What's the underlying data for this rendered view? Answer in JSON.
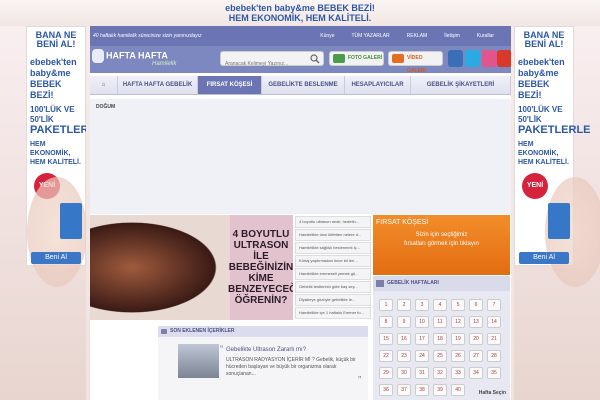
{
  "banner": {
    "line1": "ebebek'ten baby&me BEBEK BEZİ!",
    "line2": "HEM EKONOMİK, HEM KALİTELİ."
  },
  "ad": {
    "bana": "BANA NE",
    "beni": "BENİ AL!",
    "brand_lines": [
      "ebebek'ten",
      "baby&me",
      "BEBEK BEZİ!"
    ],
    "pack_prefix": "100'LÜK VE 50'LİK",
    "pack": "PAKETLERLE",
    "eco_lines": [
      "HEM EKONOMİK,",
      "HEM KALİTELİ."
    ],
    "yeni": "YENİ",
    "button": "Beni Al"
  },
  "topbar": {
    "tagline": "40 haftalık hamilelik sürecinize sizin yanınızdayız",
    "links": [
      "Künye",
      "TÜM YAZARLAR",
      "REKLAM",
      "İletişim",
      "Kurallar"
    ]
  },
  "header": {
    "logo": "HAFTA HAFTA",
    "logo_sub": "Hamilelik",
    "search_placeholder": "Aranacak Kelimeyi Yazınız...",
    "foto": "FOTO GALERİ",
    "video": "VİDEO GALERİ"
  },
  "nav": {
    "items": [
      "HAFTA HAFTA GEBELİK",
      "FIRSAT KÖŞESİ",
      "GEBELİKTE BESLENME",
      "HESAPLAYICILAR",
      "GEBELİK ŞİKAYETLERİ"
    ]
  },
  "dogum": "DOĞUM",
  "slide": {
    "text_lines": [
      "4 BOYUTLU",
      "ULTRASON İLE",
      "BEBEĞİNİZİN",
      "KİME",
      "BENZEYECEĞİNİ",
      "ÖĞRENİN?"
    ],
    "list": [
      "4 boyutlu ultrason nedir, hedefin...",
      "Hamilelikte ünsi lütfetten nelere d...",
      "Hamilelikte sağlıklı beslenmek iç...",
      "Kürtaj yaptırmadan önce bil lerı...",
      "Hamilelikte emmeseli yemek gü...",
      "Gebelik testlerinin güte baş sey...",
      "Diyabeye gözüyle gebelikte le...",
      "Hamilelikte içe 1 haftalık Emmer fo..."
    ]
  },
  "firsat": {
    "title": "FIRSAT KÖŞESİ",
    "line1": "Sizin için seçtiğimiz",
    "line2": "fırsatları görmek için tıklayın"
  },
  "haftalar": {
    "title": "GEBELİK HAFTALARI",
    "weeks": [
      "1",
      "2",
      "3",
      "4",
      "5",
      "6",
      "7",
      "8",
      "9",
      "10",
      "11",
      "12",
      "13",
      "14",
      "15",
      "16",
      "17",
      "18",
      "19",
      "20",
      "21",
      "22",
      "23",
      "24",
      "25",
      "26",
      "27",
      "28",
      "29",
      "30",
      "31",
      "32",
      "33",
      "34",
      "35",
      "36",
      "37",
      "38",
      "39",
      "40"
    ],
    "select": "Hafta Seçin"
  },
  "son": {
    "title": "SON EKLENEN İÇERİKLER",
    "item_title": "Gebelikte Ultrason Zararlı mı?",
    "item_desc": "ULTRASON RADYASYON İÇERİR Mİ ? Gebelik, küçük bir hücreden başlayan ve büyük bir organizma olarak sonuçlanan..."
  },
  "colors": {
    "accent": "#6b75b4",
    "firsat": "#ee7f1f",
    "brand_blue": "#2c57a9"
  }
}
